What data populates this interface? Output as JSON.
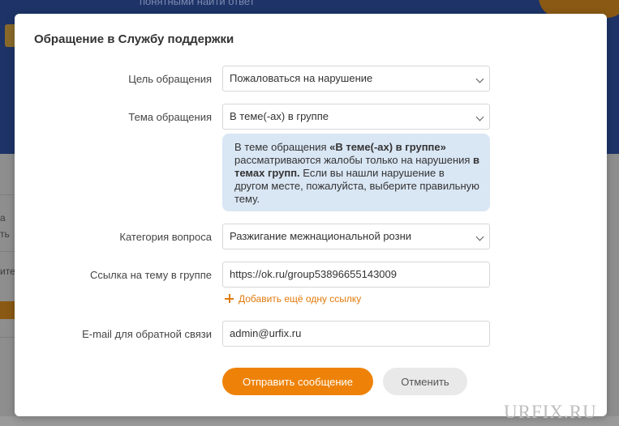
{
  "background": {
    "top_text": "понятными найти ответ",
    "left_fragments": [
      "а",
      "ть",
      "ите"
    ]
  },
  "modal": {
    "title": "Обращение в Службу поддержки",
    "fields": {
      "purpose": {
        "label": "Цель обращения",
        "value": "Пожаловаться на нарушение"
      },
      "topic": {
        "label": "Тема обращения",
        "value": "В теме(-ах) в группе"
      },
      "category": {
        "label": "Категория вопроса",
        "value": "Разжигание межнациональной розни"
      },
      "link": {
        "label": "Ссылка на тему в группе",
        "value": "https://ok.ru/group53896655143009"
      },
      "email": {
        "label": "E-mail для обратной связи",
        "value": "admin@urfix.ru"
      }
    },
    "info": {
      "part1": "В теме обращения ",
      "bold1": "«В теме(-ах) в группе»",
      "part2": " рассматриваются жалобы только на нарушения ",
      "bold2": "в темах групп.",
      "part3": " Если вы нашли нарушение в другом месте, пожалуйста, выберите правильную тему."
    },
    "add_link": "Добавить ещё одну ссылку",
    "buttons": {
      "submit": "Отправить сообщение",
      "cancel": "Отменить"
    }
  },
  "watermark": "URFIX.RU",
  "colors": {
    "accent": "#ee8208",
    "info_bg": "#d9e6f4",
    "overlay_top": "#1e3468"
  }
}
